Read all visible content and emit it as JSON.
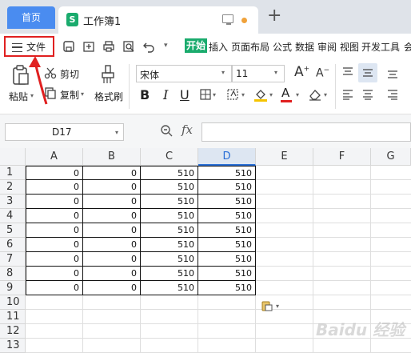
{
  "tabs": {
    "home": "首页",
    "document": "工作簿1",
    "doc_icon_letter": "S"
  },
  "menu": {
    "file": "文件",
    "items": [
      "开始",
      "插入",
      "页面布局",
      "公式",
      "数据",
      "审阅",
      "视图",
      "开发工具",
      "会"
    ]
  },
  "ribbon": {
    "paste": "粘贴",
    "cut": "剪切",
    "copy": "复制",
    "format_painter": "格式刷",
    "font_name": "宋体",
    "font_size": "11",
    "bold": "B",
    "italic": "I",
    "underline": "U",
    "font_color_letter": "A"
  },
  "formula_bar": {
    "cell_ref": "D17",
    "fx": "fx",
    "value": ""
  },
  "grid": {
    "columns": [
      "A",
      "B",
      "C",
      "D",
      "E",
      "F",
      "G"
    ],
    "selected_column": "D",
    "rows": [
      "1",
      "2",
      "3",
      "4",
      "5",
      "6",
      "7",
      "8",
      "9",
      "10",
      "11",
      "12",
      "13"
    ],
    "cells": [
      [
        "0",
        "0",
        "510",
        "510"
      ],
      [
        "0",
        "0",
        "510",
        "510"
      ],
      [
        "0",
        "0",
        "510",
        "510"
      ],
      [
        "0",
        "0",
        "510",
        "510"
      ],
      [
        "0",
        "0",
        "510",
        "510"
      ],
      [
        "0",
        "0",
        "510",
        "510"
      ],
      [
        "0",
        "0",
        "510",
        "510"
      ],
      [
        "0",
        "0",
        "510",
        "510"
      ],
      [
        "0",
        "0",
        "510",
        "510"
      ]
    ]
  },
  "watermark": "Baidu 经验",
  "colors": {
    "accent": "#4a8cf0",
    "start_tab": "#1aab6d",
    "highlight_box": "#e02020",
    "font_color": "#e02020"
  }
}
